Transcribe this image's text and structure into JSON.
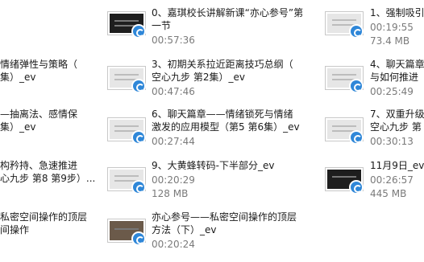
{
  "files": [
    {
      "line1": "0、嘉琪校长讲解新课“亦心参号”第",
      "line2": "一节",
      "duration": "00:57:36",
      "size": ""
    },
    {
      "line1": "1、强制吸引",
      "line2": "",
      "duration": "00:19:55",
      "size": "73.4 MB"
    },
    {
      "line1": "情绪弹性与策略（",
      "line2": "集）_ev",
      "duration": "",
      "size": ""
    },
    {
      "line1": "3、初期关系拉近距离技巧总纲（",
      "line2": "空心九步 第2集）_ev",
      "duration": "00:47:46",
      "size": ""
    },
    {
      "line1": "4、聊天篇章",
      "line2": "与如何推进",
      "duration": "00:25:49",
      "size": ""
    },
    {
      "line1": "—抽离法、感情保",
      "line2": "集）_ev",
      "duration": "",
      "size": ""
    },
    {
      "line1": "6、聊天篇章——情绪锁死与情绪",
      "line2": "激发的应用模型（第5 第6集）_ev",
      "duration": "00:27:44",
      "size": ""
    },
    {
      "line1": "7、双重升级",
      "line2": "空心九步 第",
      "duration": "00:30:13",
      "size": ""
    },
    {
      "line1": "构矜持、急速推进",
      "line2": "心九步 第8 第9步）...",
      "duration": "",
      "size": ""
    },
    {
      "line1": "9、大黄蜂转码-下半部分_ev",
      "line2": "",
      "duration": "00:20:29",
      "size": "128 MB"
    },
    {
      "line1": "11月9日_ev",
      "line2": "",
      "duration": "00:26:57",
      "size": "445 MB"
    },
    {
      "line1": "私密空间操作的顶层",
      "line2": "间操作",
      "duration": "",
      "size": ""
    },
    {
      "line1": "亦心参号——私密空间操作的顶层",
      "line2": "方法（下）_ev",
      "duration": "00:20:24",
      "size": ""
    }
  ]
}
